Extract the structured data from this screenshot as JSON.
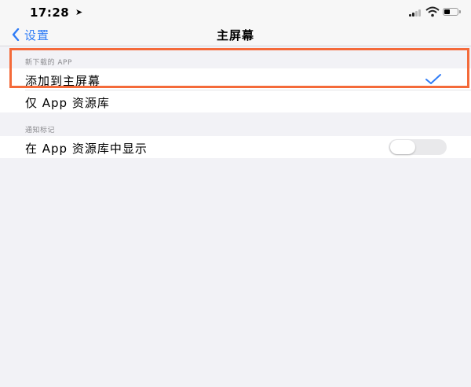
{
  "status_bar": {
    "time": "17:28",
    "location_icon": "location-arrow-icon",
    "signal_icon": "cellular-signal-icon",
    "wifi_icon": "wifi-icon",
    "battery_icon": "battery-icon"
  },
  "nav": {
    "back_label": "设置",
    "back_icon": "chevron-left-icon",
    "title": "主屏幕"
  },
  "sections": [
    {
      "header": "新下载的 APP",
      "rows": [
        {
          "label": "添加到主屏幕",
          "selected": true
        },
        {
          "label": "仅 App 资源库",
          "selected": false
        }
      ]
    },
    {
      "header": "通知标记",
      "rows": [
        {
          "label": "在 App 资源库中显示",
          "toggle_on": false
        }
      ]
    }
  ],
  "colors": {
    "accent": "#2f7cf6",
    "highlight": "#f46a3a",
    "background": "#f2f2f6"
  }
}
